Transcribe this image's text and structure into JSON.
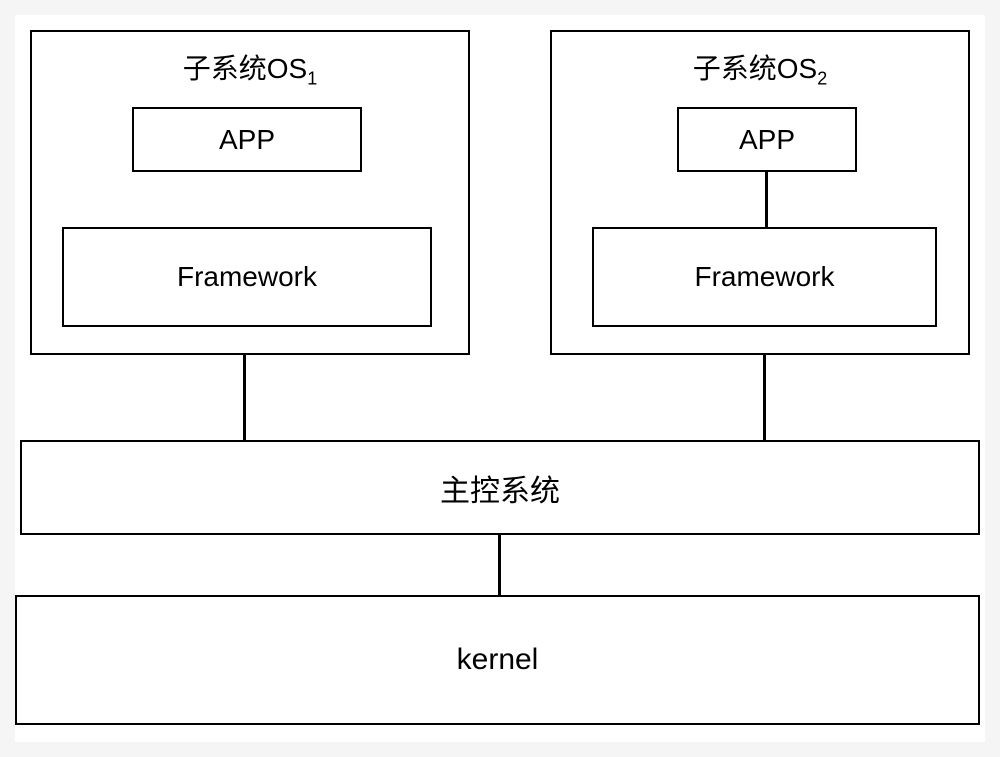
{
  "subsystem1": {
    "title_prefix": "子系统OS",
    "title_suffix": "1",
    "app_label": "APP",
    "framework_label": "Framework"
  },
  "subsystem2": {
    "title_prefix": "子系统OS",
    "title_suffix": "2",
    "app_label": "APP",
    "framework_label": "Framework"
  },
  "main_control_label": "主控系统",
  "kernel_label": "kernel"
}
